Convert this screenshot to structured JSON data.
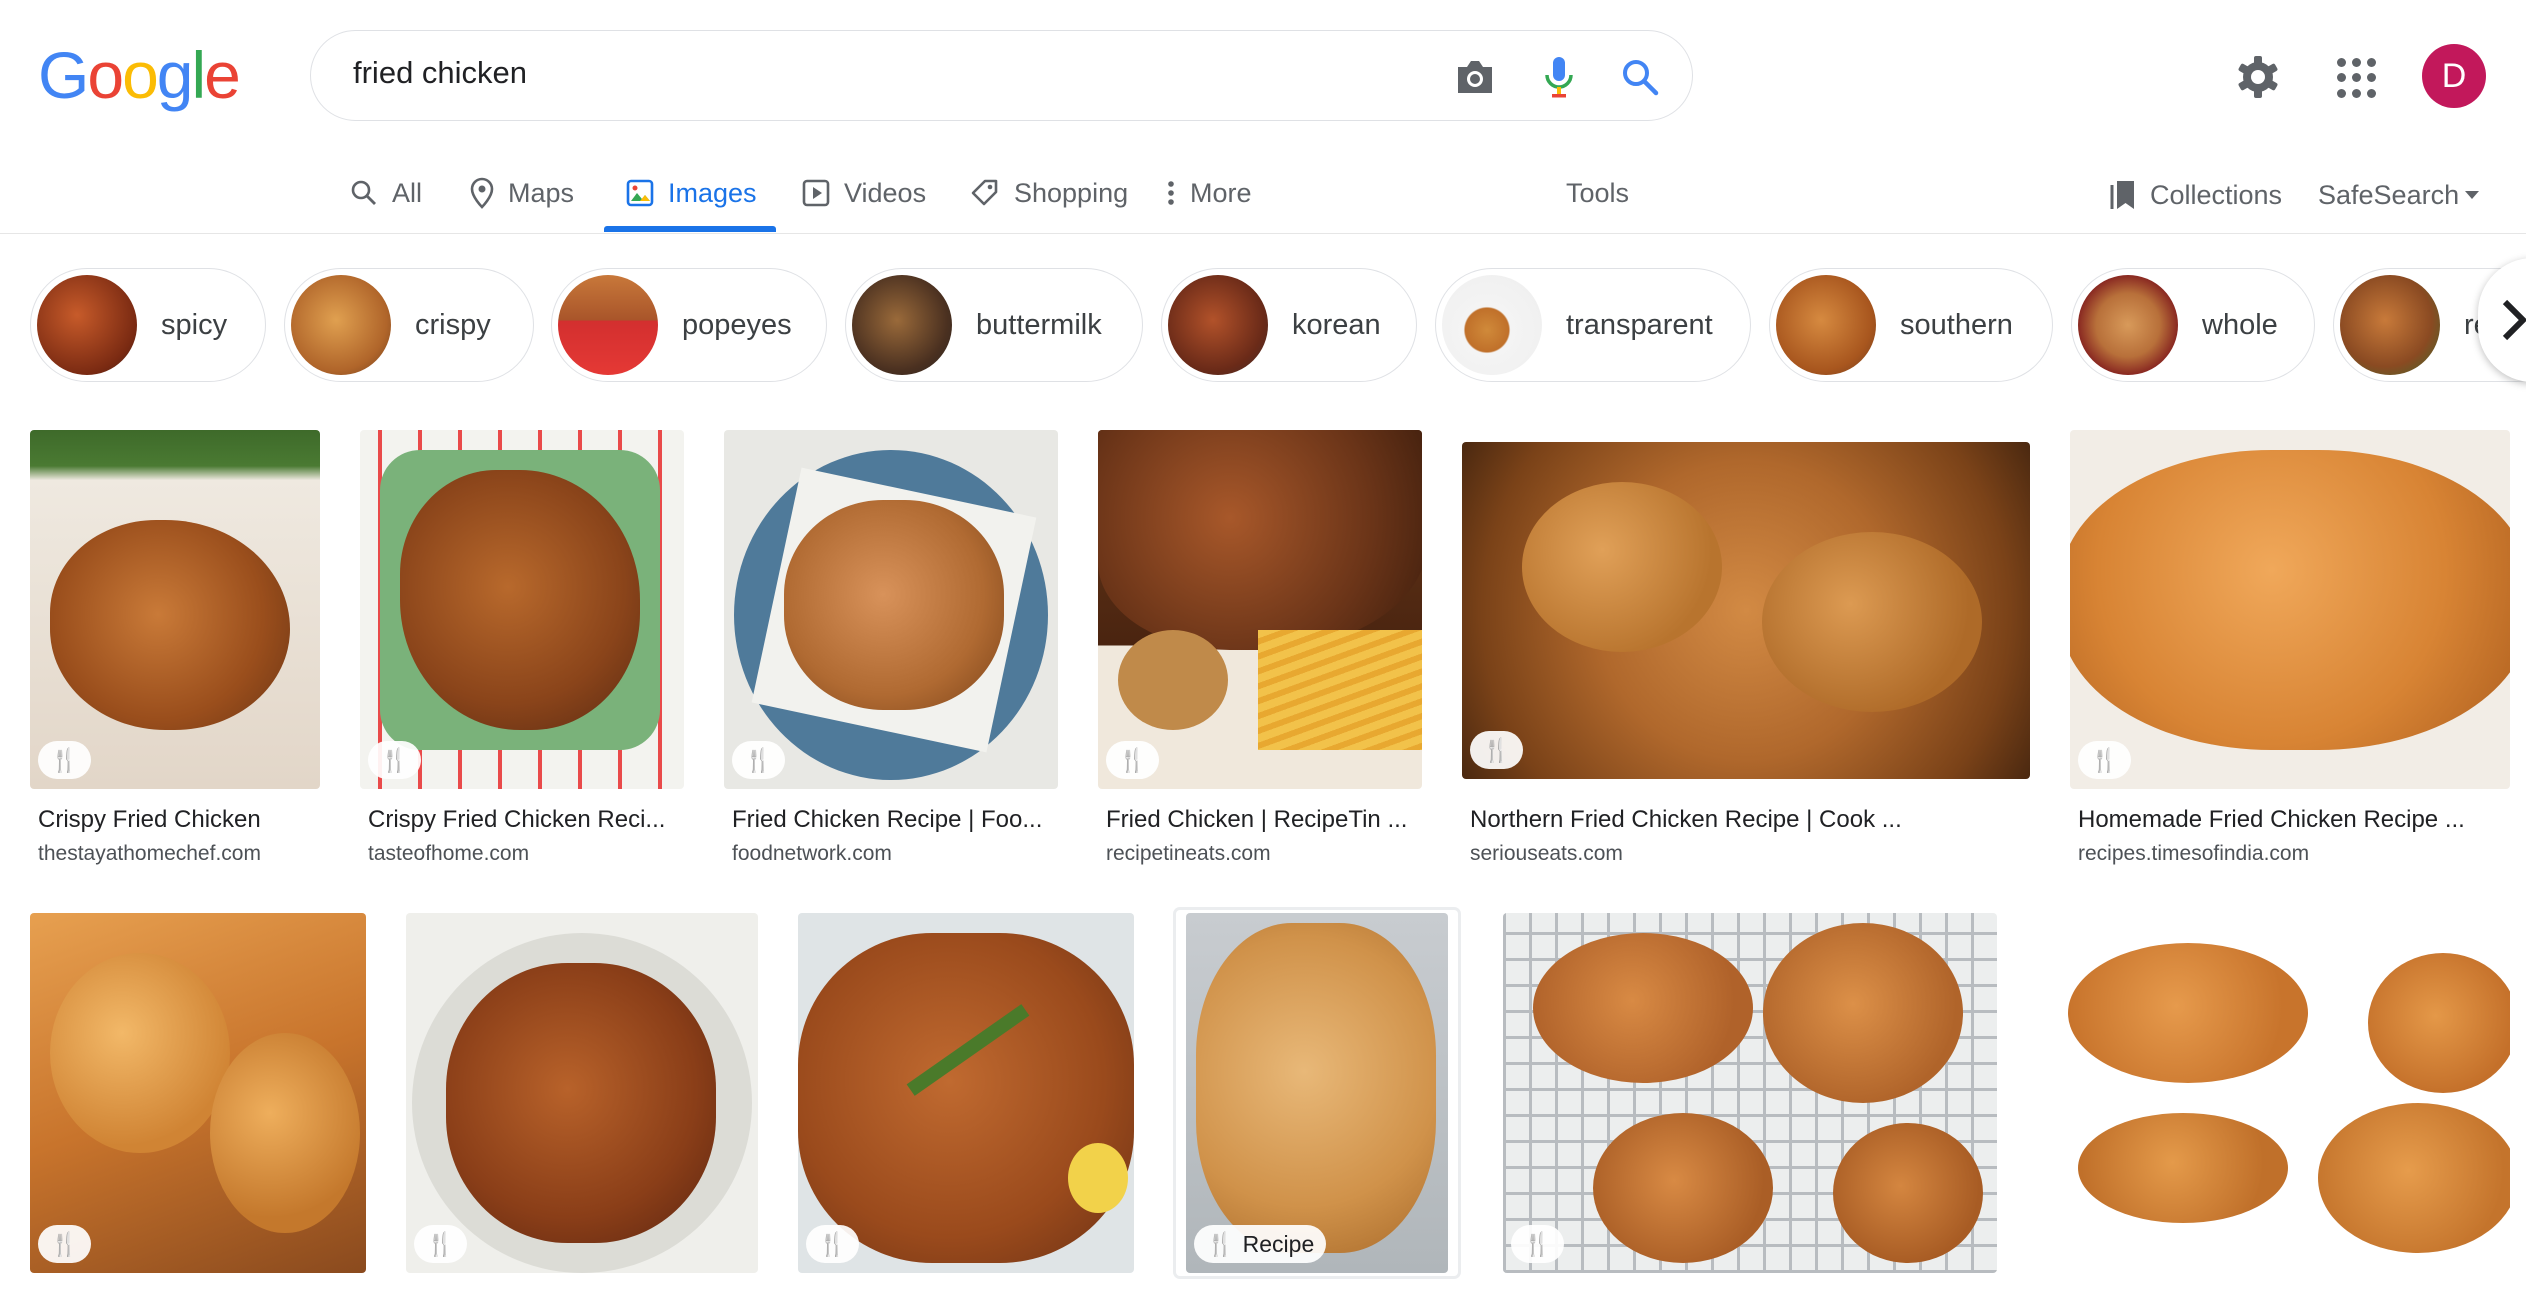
{
  "logo": {
    "letters": [
      "G",
      "o",
      "o",
      "g",
      "l",
      "e"
    ],
    "colors": [
      "#4285F4",
      "#EA4335",
      "#FBBC05",
      "#4285F4",
      "#34A853",
      "#EA4335"
    ]
  },
  "search": {
    "query": "fried chicken"
  },
  "header": {
    "avatar_letter": "D",
    "avatar_color": "#c2185b"
  },
  "tabs": [
    {
      "label": "All",
      "icon": "search-icon",
      "active": false
    },
    {
      "label": "Maps",
      "icon": "map-pin-icon",
      "active": false
    },
    {
      "label": "Images",
      "icon": "image-icon",
      "active": true
    },
    {
      "label": "Videos",
      "icon": "play-icon",
      "active": false
    },
    {
      "label": "Shopping",
      "icon": "tag-icon",
      "active": false
    },
    {
      "label": "More",
      "icon": "more-vert-icon",
      "active": false
    }
  ],
  "tools_label": "Tools",
  "collections_label": "Collections",
  "safesearch_label": "SafeSearch",
  "chips": [
    "spicy",
    "crispy",
    "popeyes",
    "buttermilk",
    "korean",
    "transparent",
    "southern",
    "whole",
    "re"
  ],
  "results_row1": [
    {
      "title": "Crispy Fried Chicken",
      "source": "thestayathomechef.com",
      "badge": ""
    },
    {
      "title": "Crispy Fried Chicken Reci...",
      "source": "tasteofhome.com",
      "badge": ""
    },
    {
      "title": "Fried Chicken Recipe | Foo...",
      "source": "foodnetwork.com",
      "badge": ""
    },
    {
      "title": "Fried Chicken | RecipeTin ...",
      "source": "recipetineats.com",
      "badge": ""
    },
    {
      "title": "Northern Fried Chicken Recipe | Cook ...",
      "source": "seriouseats.com",
      "badge": ""
    },
    {
      "title": "Homemade Fried Chicken Recipe ...",
      "source": "recipes.timesofindia.com",
      "badge": ""
    }
  ],
  "results_row2": [
    {
      "badge": ""
    },
    {
      "badge": ""
    },
    {
      "badge": ""
    },
    {
      "badge": "Recipe"
    },
    {
      "badge": ""
    }
  ],
  "colors": {
    "accent": "#1a73e8"
  }
}
